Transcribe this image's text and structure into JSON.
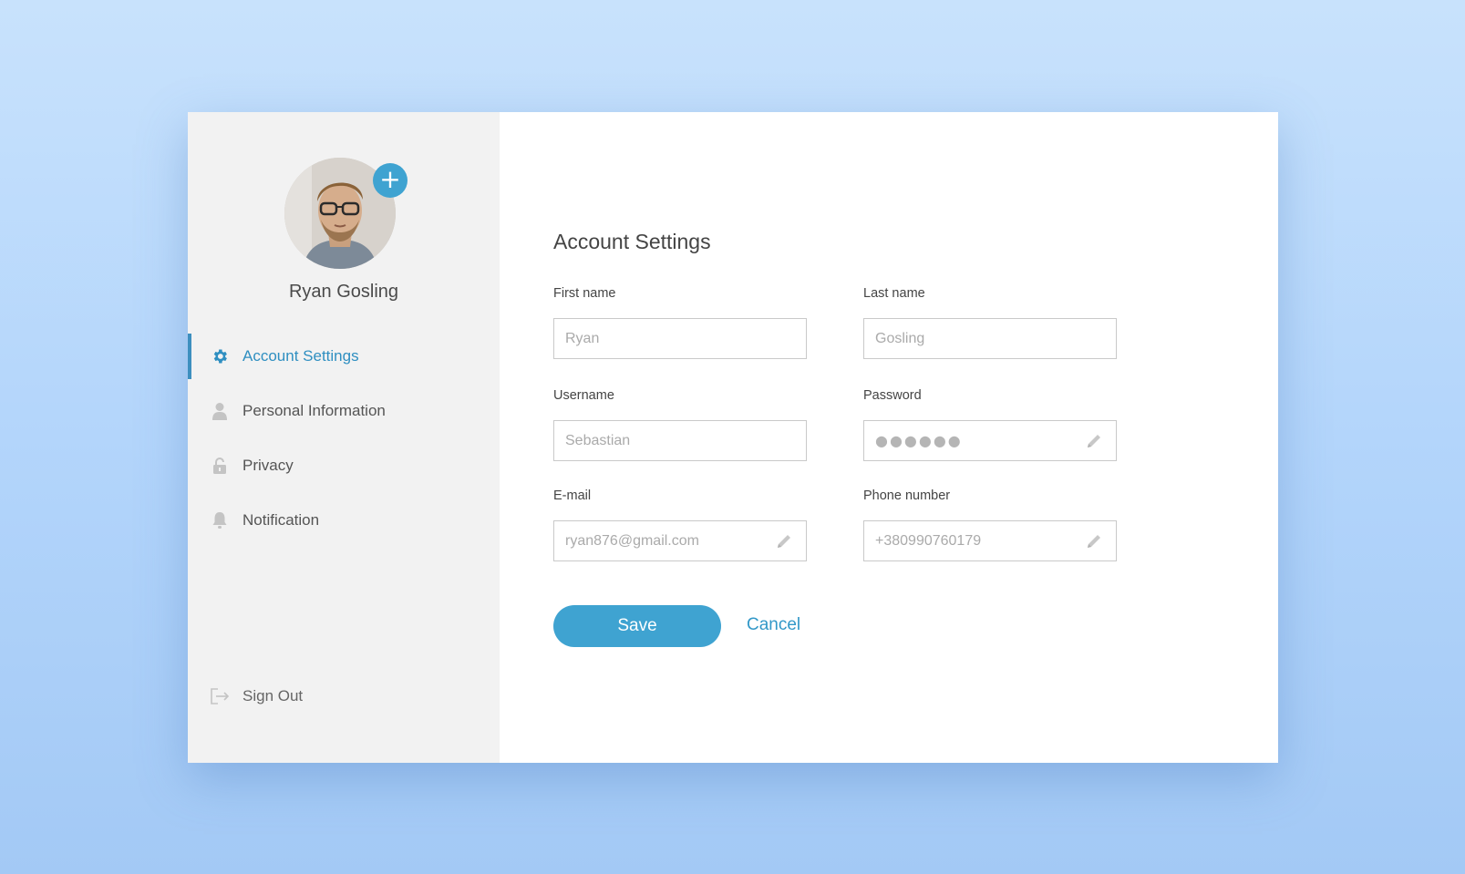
{
  "colors": {
    "accent": "#3fa3d1",
    "active_text": "#2f8fc1",
    "sidebar_bg": "#f2f2f2",
    "page_bg": "#b3d5fb"
  },
  "profile": {
    "name": "Ryan Gosling",
    "add_photo_icon": "plus-icon"
  },
  "sidebar": {
    "items": [
      {
        "label": "Account Settings",
        "icon": "gear-icon",
        "active": true
      },
      {
        "label": "Personal Information",
        "icon": "user-icon",
        "active": false
      },
      {
        "label": "Privacy",
        "icon": "lock-icon",
        "active": false
      },
      {
        "label": "Notification",
        "icon": "bell-icon",
        "active": false
      }
    ],
    "sign_out": {
      "label": "Sign Out",
      "icon": "sign-out-icon"
    }
  },
  "main": {
    "title": "Account Settings",
    "fields": {
      "first_name": {
        "label": "First name",
        "placeholder": "Ryan"
      },
      "last_name": {
        "label": "Last name",
        "placeholder": "Gosling"
      },
      "username": {
        "label": "Username",
        "placeholder": "Sebastian"
      },
      "password": {
        "label": "Password",
        "value": "●●●●●●",
        "icon": "pencil-icon"
      },
      "email": {
        "label": "E-mail",
        "placeholder": "ryan876@gmail.com",
        "icon": "pencil-icon"
      },
      "phone": {
        "label": "Phone number",
        "placeholder": "+380990760179",
        "icon": "pencil-icon"
      }
    },
    "save_label": "Save",
    "cancel_label": "Cancel"
  }
}
